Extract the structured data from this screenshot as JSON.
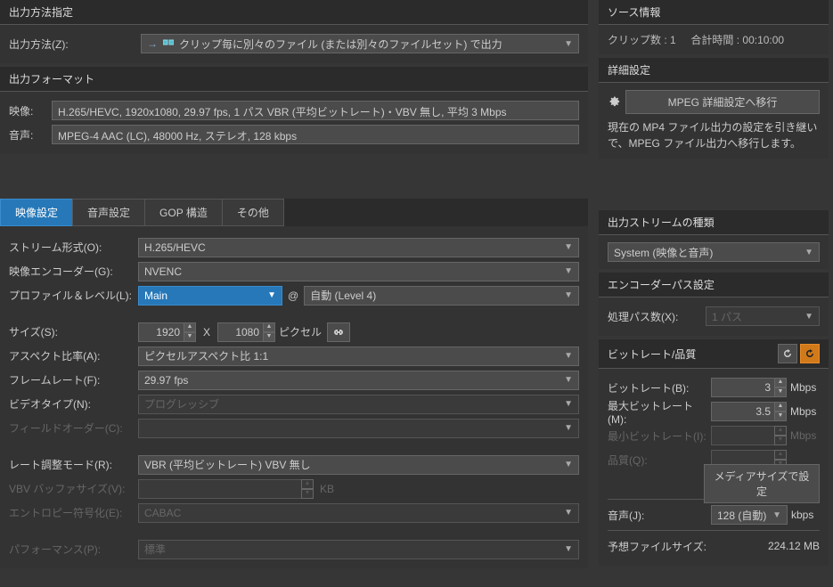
{
  "output_method": {
    "title": "出力方法指定",
    "label": "出力方法(Z):",
    "value": "クリップ毎に別々のファイル (または別々のファイルセット) で出力"
  },
  "output_format": {
    "title": "出力フォーマット",
    "video_label": "映像:",
    "video_value": "H.265/HEVC, 1920x1080, 29.97 fps, 1 パス VBR (平均ビットレート)・VBV 無し, 平均 3 Mbps",
    "audio_label": "音声:",
    "audio_value": "MPEG-4 AAC (LC), 48000 Hz, ステレオ, 128 kbps"
  },
  "source_info": {
    "title": "ソース情報",
    "clips_label": "クリップ数 :",
    "clips_value": "1",
    "duration_label": "合計時間 :",
    "duration_value": "00:10:00"
  },
  "advanced": {
    "title": "詳細設定",
    "btn": "MPEG 詳細設定へ移行",
    "desc": "現在の MP4 ファイル出力の設定を引き継いで、MPEG ファイル出力へ移行します。"
  },
  "tabs": {
    "video": "映像設定",
    "audio": "音声設定",
    "gop": "GOP 構造",
    "other": "その他"
  },
  "video": {
    "stream_type_label": "ストリーム形式(O):",
    "stream_type": "H.265/HEVC",
    "encoder_label": "映像エンコーダー(G):",
    "encoder": "NVENC",
    "profile_label": "プロファイル＆レベル(L):",
    "profile": "Main",
    "at": "@",
    "level": "自動 (Level 4)",
    "size_label": "サイズ(S):",
    "width": "1920",
    "x": "X",
    "height": "1080",
    "size_unit": "ピクセル",
    "aspect_label": "アスペクト比率(A):",
    "aspect": "ピクセルアスペクト比 1:1",
    "framerate_label": "フレームレート(F):",
    "framerate": "29.97 fps",
    "videotype_label": "ビデオタイプ(N):",
    "videotype": "プログレッシブ",
    "fieldorder_label": "フィールドオーダー(C):",
    "ratecontrol_label": "レート調整モード(R):",
    "ratecontrol": "VBR (平均ビットレート) VBV 無し",
    "vbv_label": "VBV バッファサイズ(V):",
    "vbv_unit": "KB",
    "entropy_label": "エントロピー符号化(E):",
    "entropy": "CABAC",
    "performance_label": "パフォーマンス(P):",
    "performance": "標準"
  },
  "out_stream": {
    "title": "出力ストリームの種類",
    "value": "System (映像と音声)"
  },
  "enc_pass": {
    "title": "エンコーダーパス設定",
    "label": "処理パス数(X):",
    "value": "1 パス"
  },
  "bitrate": {
    "title": "ビットレート/品質",
    "bitrate_label": "ビットレート(B):",
    "bitrate": "3",
    "unit": "Mbps",
    "max_label": "最大ビットレート(M):",
    "max": "3.5",
    "min_label": "最小ビットレート(I):",
    "quality_label": "品質(Q):",
    "media_btn": "メディアサイズで設定",
    "audio_label": "音声(J):",
    "audio": "128 (自動)",
    "audio_unit": "kbps",
    "est_label": "予想ファイルサイズ:",
    "est": "224.12 MB"
  }
}
